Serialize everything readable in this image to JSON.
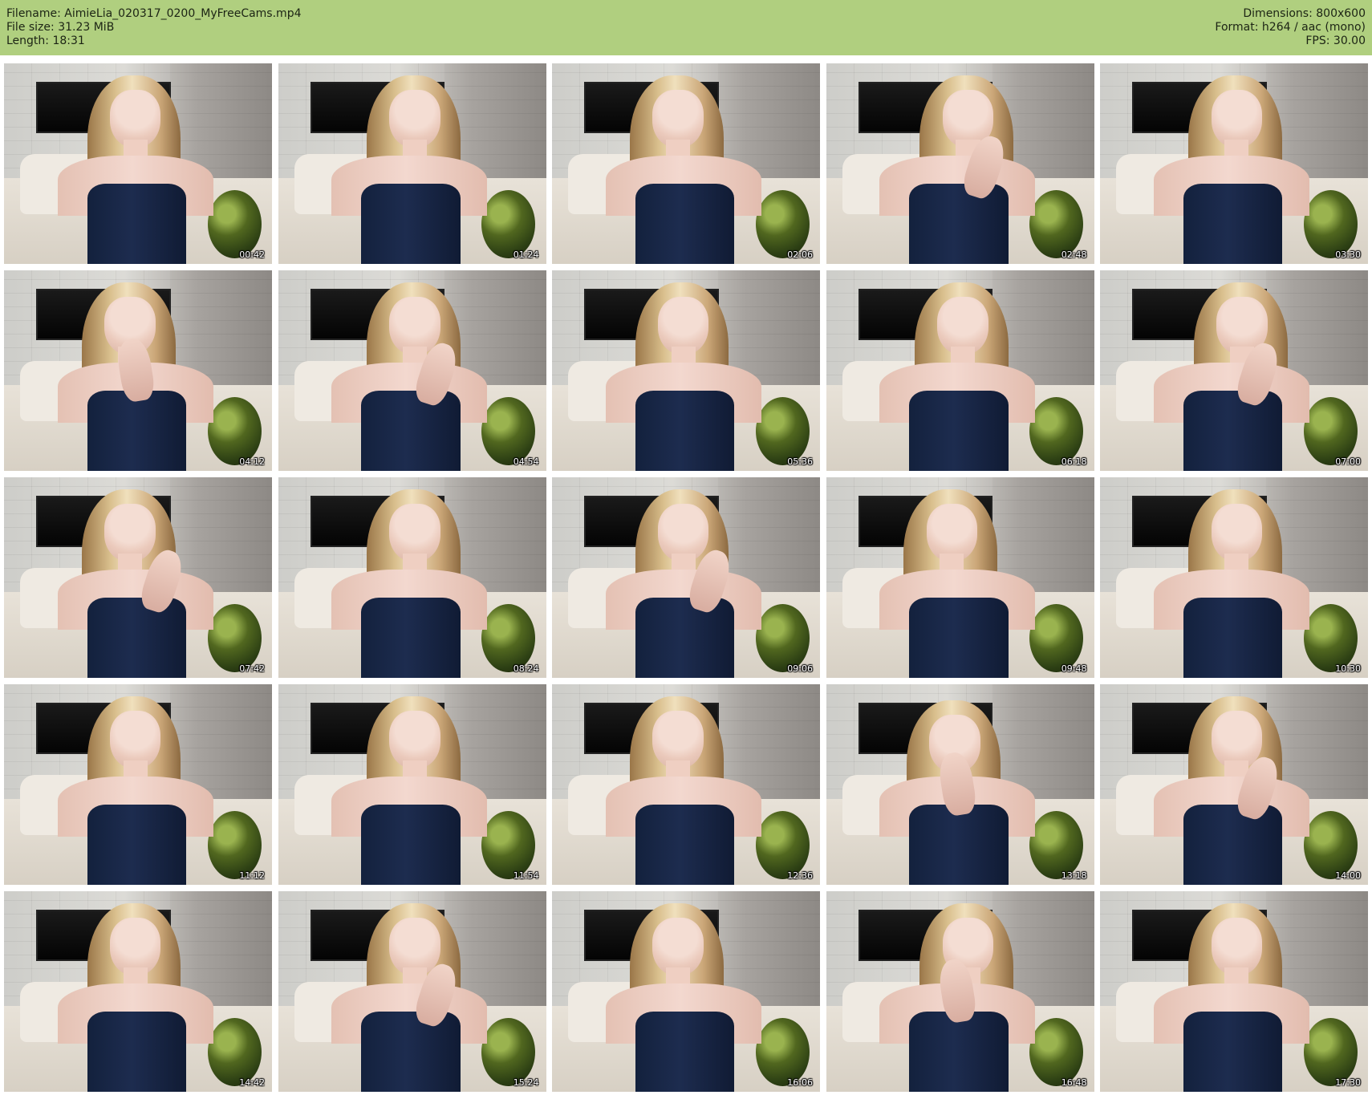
{
  "header": {
    "left": {
      "filename": "Filename: AimieLia_020317_0200_MyFreeCams.mp4",
      "file_size": "File size: 31.23 MiB",
      "length": "Length: 18:31"
    },
    "right": {
      "dimensions": "Dimensions: 800x600",
      "format": "Format: h264 / aac (mono)",
      "fps": "FPS: 30.00"
    }
  },
  "thumbnails": [
    {
      "time": "00:42",
      "pose": "pose-0"
    },
    {
      "time": "01:24",
      "pose": "pose-1"
    },
    {
      "time": "02:06",
      "pose": "pose-2"
    },
    {
      "time": "02:48",
      "pose": "pose-3 hand-pose hand-right"
    },
    {
      "time": "03:30",
      "pose": "pose-1"
    },
    {
      "time": "04:12",
      "pose": "pose-2 hand-pose"
    },
    {
      "time": "04:54",
      "pose": "pose-1 hand-pose hand-right"
    },
    {
      "time": "05:36",
      "pose": "pose-0"
    },
    {
      "time": "06:18",
      "pose": "pose-1"
    },
    {
      "time": "07:00",
      "pose": "pose-3 hand-pose hand-right"
    },
    {
      "time": "07:42",
      "pose": "pose-2 hand-pose hand-right"
    },
    {
      "time": "08:24",
      "pose": "pose-1"
    },
    {
      "time": "09:06",
      "pose": "pose-0 hand-pose hand-right"
    },
    {
      "time": "09:48",
      "pose": "pose-2"
    },
    {
      "time": "10:30",
      "pose": "pose-1"
    },
    {
      "time": "11:12",
      "pose": "pose-0"
    },
    {
      "time": "11:54",
      "pose": "pose-1"
    },
    {
      "time": "12:36",
      "pose": "pose-2"
    },
    {
      "time": "13:18",
      "pose": "pose-4 hand-pose"
    },
    {
      "time": "14:00",
      "pose": "pose-1 hand-pose hand-right"
    },
    {
      "time": "14:42",
      "pose": "pose-0"
    },
    {
      "time": "15:24",
      "pose": "pose-1 hand-pose hand-right"
    },
    {
      "time": "16:06",
      "pose": "pose-2"
    },
    {
      "time": "16:48",
      "pose": "pose-3 hand-pose"
    },
    {
      "time": "17:30",
      "pose": "pose-1"
    }
  ]
}
